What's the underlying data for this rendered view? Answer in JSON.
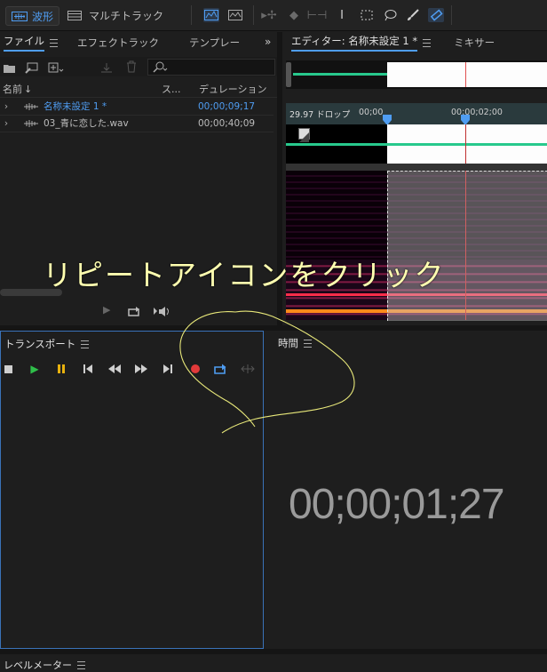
{
  "topbar": {
    "waveform_label": "波形",
    "multitrack_label": "マルチトラック"
  },
  "files_panel": {
    "tabs": [
      "ファイル",
      "エフェクトラック",
      "テンプレー"
    ],
    "col_name": "名前",
    "col_status": "ス...",
    "col_duration": "デュレーション",
    "files": [
      {
        "name": "名称未設定 1 *",
        "duration": "00;00;09;17"
      },
      {
        "name": "03_青に恋した.wav",
        "duration": "00;00;40;09"
      }
    ]
  },
  "editor": {
    "tab_editor": "エディター: 名称未設定 1 *",
    "tab_mixer": "ミキサー",
    "timecode_format": "29.97 ドロップ",
    "ruler_start": "00;00",
    "ruler_mid": "00;00;02;00"
  },
  "transport": {
    "title": "トランスポート"
  },
  "time_panel": {
    "title": "時間",
    "current_time": "00;00;01;27"
  },
  "level_meter": {
    "title": "レベルメーター"
  },
  "annotation": {
    "text": "リピートアイコンをクリック"
  },
  "colors": {
    "accent": "#4f9df2",
    "waveform_green": "#28c98d",
    "record_red": "#e23a3a",
    "play_green": "#2fbf4a",
    "pause_yellow": "#e8b10e",
    "annotation_yellow": "#ffffb0"
  }
}
